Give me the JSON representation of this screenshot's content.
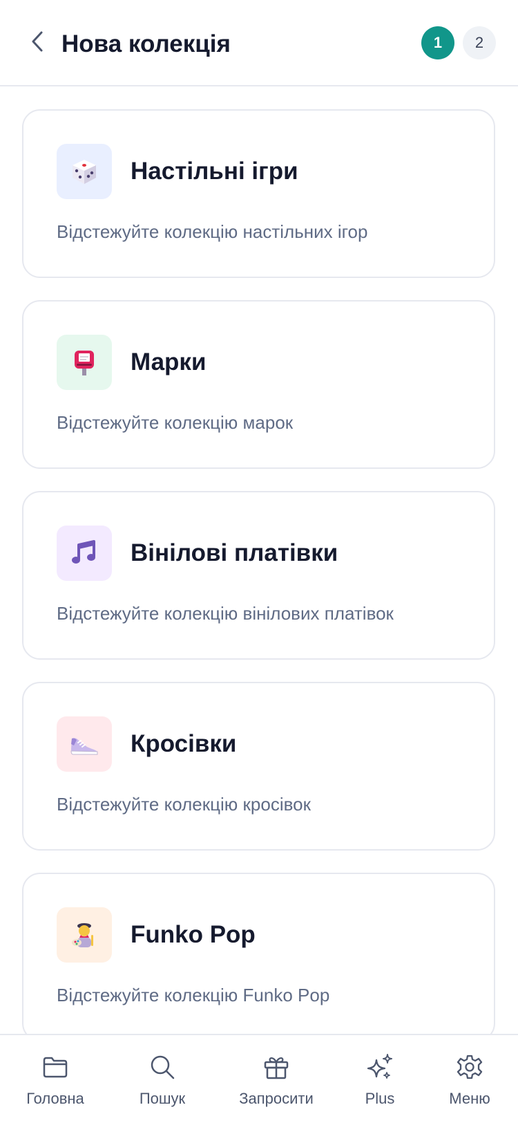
{
  "header": {
    "title": "Нова колекція",
    "steps": [
      "1",
      "2"
    ],
    "accent_color": "#11968a"
  },
  "collections": [
    {
      "title": "Настільні ігри",
      "description": "Відстежуйте колекцію настільних ігор",
      "icon": "dice-icon",
      "tile_color": "#e9efff"
    },
    {
      "title": "Марки",
      "description": "Відстежуйте колекцію марок",
      "icon": "postbox-icon",
      "tile_color": "#e6f8ee"
    },
    {
      "title": "Вінілові платівки",
      "description": "Відстежуйте колекцію вінілових платівок",
      "icon": "music-note-icon",
      "tile_color": "#f3eaff"
    },
    {
      "title": "Кросівки",
      "description": "Відстежуйте колекцію кросівок",
      "icon": "sneaker-icon",
      "tile_color": "#ffe9ec"
    },
    {
      "title": "Funko Pop",
      "description": "Відстежуйте колекцію Funko Pop",
      "icon": "figure-icon",
      "tile_color": "#fff0e3"
    }
  ],
  "bottom_nav": [
    {
      "label": "Головна",
      "icon": "folder-icon"
    },
    {
      "label": "Пошук",
      "icon": "search-icon"
    },
    {
      "label": "Запросити",
      "icon": "gift-icon"
    },
    {
      "label": "Plus",
      "icon": "sparkles-icon"
    },
    {
      "label": "Меню",
      "icon": "gear-icon"
    }
  ]
}
